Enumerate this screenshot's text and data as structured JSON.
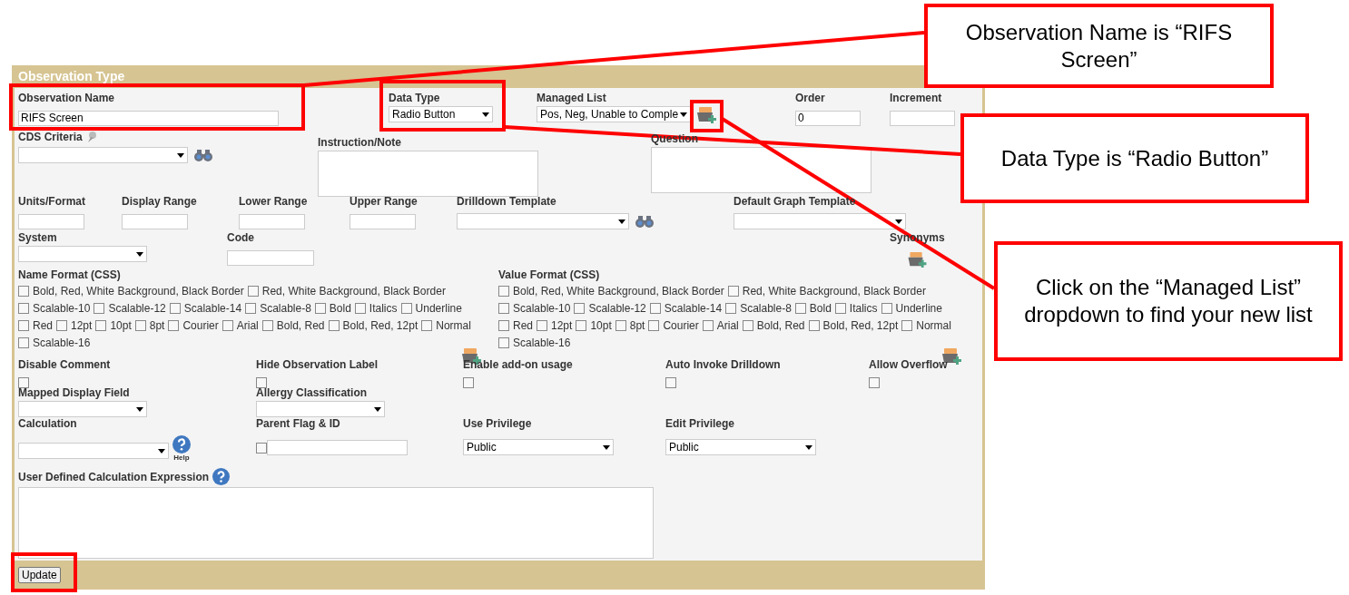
{
  "form": {
    "title": "Observation Type",
    "observation_name": {
      "label": "Observation Name",
      "value": "RIFS Screen"
    },
    "data_type": {
      "label": "Data Type",
      "value": "Radio Button"
    },
    "managed_list": {
      "label": "Managed List",
      "value": "Pos, Neg, Unable to Comple"
    },
    "order": {
      "label": "Order",
      "value": "0"
    },
    "increment": {
      "label": "Increment"
    },
    "cds_criteria": {
      "label": "CDS Criteria"
    },
    "instruction_note": {
      "label": "Instruction/Note"
    },
    "question": {
      "label": "Question"
    },
    "units_format": {
      "label": "Units/Format"
    },
    "display_range": {
      "label": "Display Range"
    },
    "lower_range": {
      "label": "Lower Range"
    },
    "upper_range": {
      "label": "Upper Range"
    },
    "drilldown_template": {
      "label": "Drilldown Template"
    },
    "default_graph_template": {
      "label": "Default Graph Template"
    },
    "system": {
      "label": "System"
    },
    "code": {
      "label": "Code"
    },
    "synonyms": {
      "label": "Synonyms"
    },
    "name_format": {
      "label": "Name Format (CSS)",
      "options": [
        {
          "label": "Bold, Red, White Background, Black Border",
          "checked": false
        },
        {
          "label": "Red, White Background, Black Border",
          "checked": false
        },
        {
          "label": "Scalable-10",
          "checked": false
        },
        {
          "label": "Scalable-12",
          "checked": false
        },
        {
          "label": "Scalable-14",
          "checked": false
        },
        {
          "label": "Scalable-8",
          "checked": false
        },
        {
          "label": "Bold",
          "checked": false
        },
        {
          "label": "Italics",
          "checked": false
        },
        {
          "label": "Underline",
          "checked": false
        },
        {
          "label": "Red",
          "checked": false
        },
        {
          "label": "12pt",
          "checked": false
        },
        {
          "label": "10pt",
          "checked": false
        },
        {
          "label": "8pt",
          "checked": false
        },
        {
          "label": "Courier",
          "checked": false
        },
        {
          "label": "Arial",
          "checked": false
        },
        {
          "label": "Bold, Red",
          "checked": false
        },
        {
          "label": "Bold, Red, 12pt",
          "checked": false
        },
        {
          "label": "Normal",
          "checked": false
        },
        {
          "label": "Scalable-16",
          "checked": false
        }
      ]
    },
    "value_format": {
      "label": "Value Format (CSS)",
      "options": [
        {
          "label": "Bold, Red, White Background, Black Border",
          "checked": false
        },
        {
          "label": "Red, White Background, Black Border",
          "checked": false
        },
        {
          "label": "Scalable-10",
          "checked": false
        },
        {
          "label": "Scalable-12",
          "checked": false
        },
        {
          "label": "Scalable-14",
          "checked": false
        },
        {
          "label": "Scalable-8",
          "checked": false
        },
        {
          "label": "Bold",
          "checked": false
        },
        {
          "label": "Italics",
          "checked": false
        },
        {
          "label": "Underline",
          "checked": false
        },
        {
          "label": "Red",
          "checked": false
        },
        {
          "label": "12pt",
          "checked": false
        },
        {
          "label": "10pt",
          "checked": false
        },
        {
          "label": "8pt",
          "checked": false
        },
        {
          "label": "Courier",
          "checked": false
        },
        {
          "label": "Arial",
          "checked": false
        },
        {
          "label": "Bold, Red",
          "checked": false
        },
        {
          "label": "Bold, Red, 12pt",
          "checked": false
        },
        {
          "label": "Normal",
          "checked": false
        },
        {
          "label": "Scalable-16",
          "checked": false
        }
      ]
    },
    "flags": [
      {
        "label": "Disable Comment",
        "checked": false
      },
      {
        "label": "Hide Observation Label",
        "checked": false
      },
      {
        "label": "Enable add-on usage",
        "checked": false
      },
      {
        "label": "Auto Invoke Drilldown",
        "checked": false
      },
      {
        "label": "Allow Overflow",
        "checked": false
      }
    ],
    "mapped_display_field": {
      "label": "Mapped Display Field"
    },
    "allergy_classification": {
      "label": "Allergy Classification"
    },
    "calculation": {
      "label": "Calculation",
      "help": "Help"
    },
    "parent_flag": {
      "label": "Parent Flag & ID",
      "checked": false
    },
    "use_privilege": {
      "label": "Use Privilege",
      "value": "Public"
    },
    "edit_privilege": {
      "label": "Edit Privilege",
      "value": "Public"
    },
    "expression": {
      "label": "User Defined Calculation Expression"
    },
    "update_button": "Update"
  },
  "callouts": [
    {
      "text": "Observation Name is “RIFS Screen”"
    },
    {
      "text": "Data Type is “Radio Button”"
    },
    {
      "text": "Click on the “Managed List” dropdown to find your new list"
    }
  ]
}
